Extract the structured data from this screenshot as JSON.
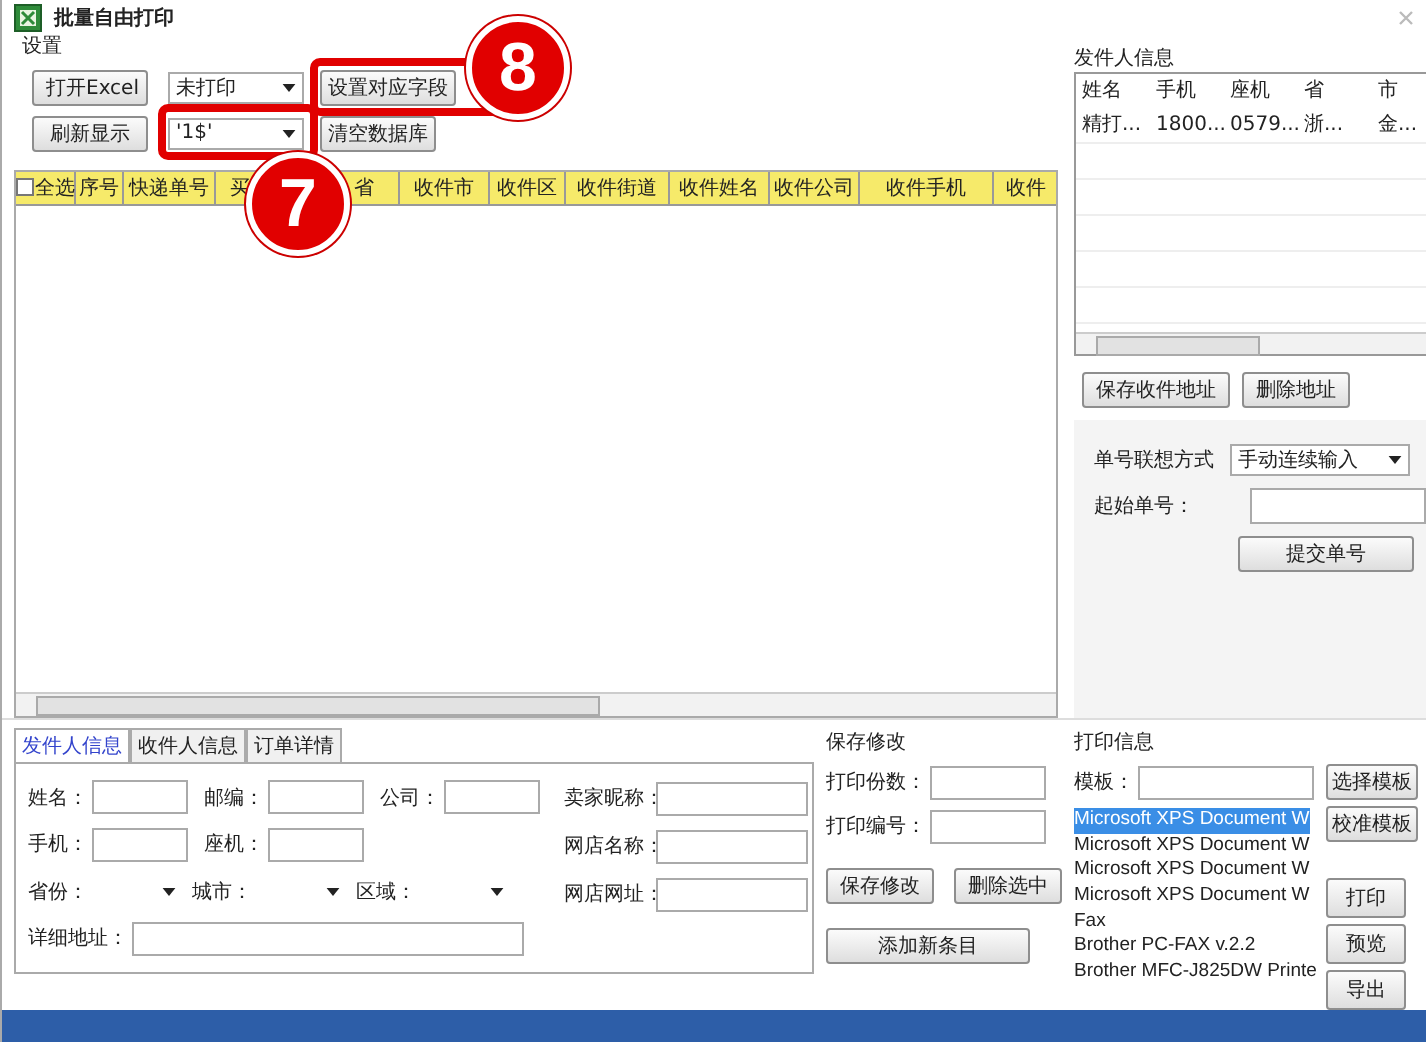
{
  "window": {
    "title": "批量自由打印"
  },
  "settings": {
    "title": "设置",
    "open_excel": "打开Excel",
    "refresh": "刷新显示",
    "status_select": "未打印",
    "sheet_select": "'1$'",
    "map_fields": "设置对应字段",
    "clear_db": "清空数据库"
  },
  "callouts": [
    {
      "label": "8",
      "kind": "map"
    },
    {
      "label": "7",
      "kind": "sheet"
    }
  ],
  "table": {
    "select_all": {
      "label": "全选",
      "checked": false
    },
    "columns": [
      "序号",
      "快递单号",
      "买",
      "省",
      "收件市",
      "收件区",
      "收件街道",
      "收件姓名",
      "收件公司",
      "收件手机",
      "收件"
    ]
  },
  "sender_info": {
    "title": "发件人信息",
    "columns": [
      "姓名",
      "手机",
      "座机",
      "省",
      "市"
    ],
    "rows": [
      [
        "精打...",
        "1800...",
        "0579...",
        "浙...",
        "金..."
      ]
    ],
    "buttons": [
      "保存收件地址",
      "删除地址"
    ]
  },
  "tracking": {
    "mode_label": "单号联想方式",
    "mode_value": "手动连续输入",
    "start_label": "起始单号：",
    "submit": "提交单号"
  },
  "tabs": [
    {
      "label": "发件人信息",
      "selected": true
    },
    {
      "label": "收件人信息",
      "selected": false
    },
    {
      "label": "订单详情",
      "selected": false
    }
  ],
  "sender_form": {
    "rows": [
      [
        {
          "label": "姓名：",
          "kind": "text"
        },
        {
          "label": "邮编：",
          "kind": "text"
        },
        {
          "label": "公司：",
          "kind": "text"
        }
      ],
      [
        {
          "label": "手机：",
          "kind": "text"
        },
        {
          "label": "座机：",
          "kind": "text"
        }
      ],
      [
        {
          "label": "省份：",
          "kind": "select"
        },
        {
          "label": "城市：",
          "kind": "select"
        },
        {
          "label": "区域：",
          "kind": "select"
        }
      ],
      [
        {
          "label": "详细地址：",
          "kind": "wide"
        }
      ]
    ],
    "shop_fields": [
      "卖家昵称：",
      "网店名称：",
      "网店网址："
    ]
  },
  "save_group": {
    "title": "保存修改",
    "fields": [
      "打印份数：",
      "打印编号："
    ],
    "buttons": [
      "保存修改",
      "删除选中"
    ],
    "add": "添加新条目"
  },
  "print_group": {
    "title": "打印信息",
    "template_label": "模板：",
    "printers": [
      {
        "name": "Microsoft XPS Document W",
        "selected": true
      },
      {
        "name": "Microsoft XPS Document W",
        "selected": false
      },
      {
        "name": "Microsoft XPS Document W",
        "selected": false
      },
      {
        "name": "Microsoft XPS Document W",
        "selected": false
      },
      {
        "name": "Fax",
        "selected": false
      },
      {
        "name": "Brother PC-FAX v.2.2",
        "selected": false
      },
      {
        "name": "Brother MFC-J825DW Printe",
        "selected": false
      }
    ],
    "template_buttons": [
      "选择模板",
      "校准模板"
    ],
    "action_buttons": [
      "打印",
      "预览",
      "导出"
    ]
  }
}
